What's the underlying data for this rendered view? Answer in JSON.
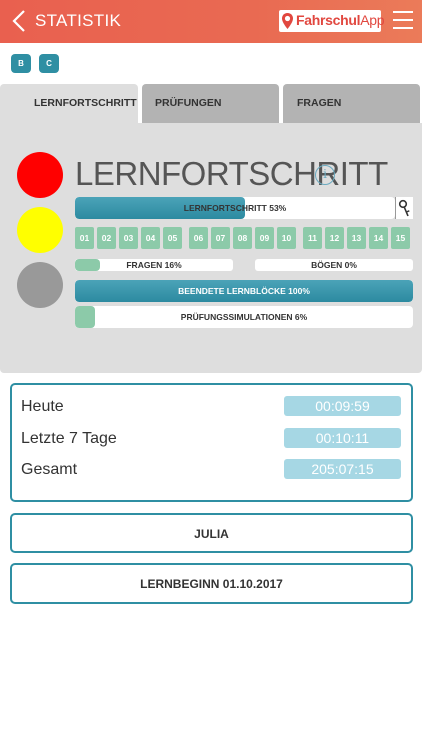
{
  "header": {
    "title": "STATISTIK",
    "logo_bold": "Fahrschul",
    "logo_light": "App"
  },
  "licenses": [
    "B",
    "C"
  ],
  "tabs": [
    {
      "label": "LERNFORTSCHRITT",
      "active": true
    },
    {
      "label": "PRÜFUNGEN",
      "active": false
    },
    {
      "label": "FRAGEN",
      "active": false
    }
  ],
  "progress": {
    "title": "LERNFORTSCHRITT",
    "main_bar": {
      "label": "LERNFORTSCHRITT  53%",
      "value": 0.53
    },
    "numbers": [
      "01",
      "02",
      "03",
      "04",
      "05",
      "06",
      "07",
      "08",
      "09",
      "10",
      "11",
      "12",
      "13",
      "14",
      "15"
    ],
    "fragen": {
      "label": "FRAGEN  16%",
      "value": 0.16
    },
    "boegen": {
      "label": "BÖGEN  0%",
      "value": 0.0
    },
    "lernbloecke": {
      "label": "BEENDETE LERNBLÖCKE  100%",
      "value": 1.0
    },
    "pruefungssimulationen": {
      "label": "PRÜFUNGSSIMULATIONEN  6%",
      "value": 0.06
    },
    "traffic_light_colors": [
      "#ff0000",
      "#ffff00",
      "#999999"
    ]
  },
  "times": [
    {
      "label": "Heute",
      "value": "00:09:59"
    },
    {
      "label": "Letzte 7 Tage",
      "value": "00:10:11"
    },
    {
      "label": "Gesamt",
      "value": "205:07:15"
    }
  ],
  "user_name": "JULIA",
  "lernbeginn": "LERNBEGINN  01.10.2017",
  "colors": {
    "accent": "#2f8fa3",
    "header": "#e9604f",
    "green": "#8ccaa9"
  }
}
